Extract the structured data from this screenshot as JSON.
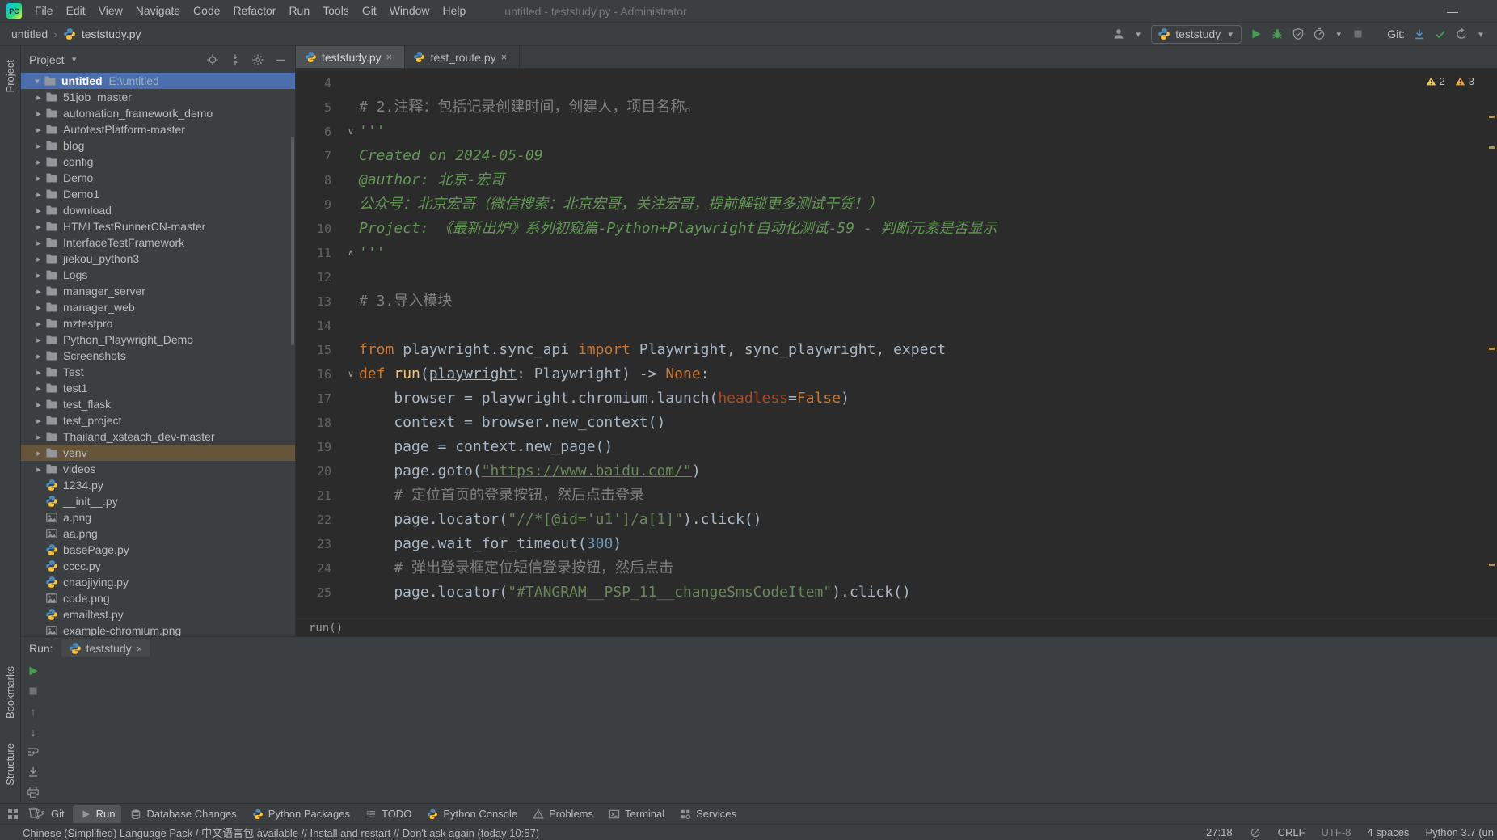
{
  "accent_colors": {
    "selection_blue": "#4b6eaf",
    "scope_brown": "#66543b",
    "run_green": "#499C54",
    "warning_yellow": "#f2c55c",
    "keyword_orange": "#cc7832",
    "string_green": "#6a8759",
    "docstring_green": "#629755",
    "comment_gray": "#808080",
    "number_blue": "#6897bb"
  },
  "title_bar": {
    "logo_text": "PC",
    "menus": [
      "File",
      "Edit",
      "View",
      "Navigate",
      "Code",
      "Refactor",
      "Run",
      "Tools",
      "Git",
      "Window",
      "Help"
    ],
    "window_title": "untitled - teststudy.py - Administrator",
    "minimize_glyph": "—"
  },
  "nav_bar": {
    "breadcrumb_project": "untitled",
    "breadcrumb_separator": "›",
    "breadcrumb_file": "teststudy.py",
    "run_config": "teststudy",
    "git_label": "Git:"
  },
  "tool_strips": {
    "left_top": "Project",
    "left_bottom": [
      "Bookmarks",
      "Structure"
    ]
  },
  "project_panel": {
    "header_label": "Project",
    "root_name": "untitled",
    "root_path": "E:\\untitled",
    "items": [
      {
        "name": "51job_master",
        "type": "folder"
      },
      {
        "name": "automation_framework_demo",
        "type": "folder"
      },
      {
        "name": "AutotestPlatform-master",
        "type": "folder"
      },
      {
        "name": "blog",
        "type": "folder"
      },
      {
        "name": "config",
        "type": "folder"
      },
      {
        "name": "Demo",
        "type": "folder"
      },
      {
        "name": "Demo1",
        "type": "folder"
      },
      {
        "name": "download",
        "type": "folder"
      },
      {
        "name": "HTMLTestRunnerCN-master",
        "type": "folder"
      },
      {
        "name": "InterfaceTestFramework",
        "type": "folder"
      },
      {
        "name": "jiekou_python3",
        "type": "folder"
      },
      {
        "name": "Logs",
        "type": "folder"
      },
      {
        "name": "manager_server",
        "type": "folder"
      },
      {
        "name": "manager_web",
        "type": "folder"
      },
      {
        "name": "mztestpro",
        "type": "folder"
      },
      {
        "name": "Python_Playwright_Demo",
        "type": "folder"
      },
      {
        "name": "Screenshots",
        "type": "folder"
      },
      {
        "name": "Test",
        "type": "folder"
      },
      {
        "name": "test1",
        "type": "folder"
      },
      {
        "name": "test_flask",
        "type": "folder"
      },
      {
        "name": "test_project",
        "type": "folder"
      },
      {
        "name": "Thailand_xsteach_dev-master",
        "type": "folder"
      },
      {
        "name": "venv",
        "type": "folder",
        "highlight": true
      },
      {
        "name": "videos",
        "type": "folder"
      },
      {
        "name": "1234.py",
        "type": "py"
      },
      {
        "name": "__init__.py",
        "type": "py"
      },
      {
        "name": "a.png",
        "type": "img"
      },
      {
        "name": "aa.png",
        "type": "img"
      },
      {
        "name": "basePage.py",
        "type": "py"
      },
      {
        "name": "cccc.py",
        "type": "py"
      },
      {
        "name": "chaojiying.py",
        "type": "py"
      },
      {
        "name": "code.png",
        "type": "img"
      },
      {
        "name": "emailtest.py",
        "type": "py"
      },
      {
        "name": "example-chromium.png",
        "type": "img"
      }
    ]
  },
  "editor": {
    "tabs": [
      {
        "label": "teststudy.py",
        "active": true
      },
      {
        "label": "test_route.py",
        "active": false
      }
    ],
    "inspections": [
      {
        "icon": "warning-icon",
        "count": "2"
      },
      {
        "icon": "warning2-icon",
        "count": "3"
      }
    ],
    "breadcrumb": "run()",
    "lines": [
      {
        "no": "4",
        "tokens": []
      },
      {
        "no": "5",
        "tokens": [
          [
            "com",
            "# 2.注释：包括记录创建时间，创建人，项目名称。"
          ]
        ]
      },
      {
        "no": "6",
        "fold": "open",
        "tokens": [
          [
            "doc",
            "'''"
          ]
        ]
      },
      {
        "no": "7",
        "tokens": [
          [
            "doc",
            "Created on 2024-05-09"
          ]
        ]
      },
      {
        "no": "8",
        "tokens": [
          [
            "doc",
            "@author: 北京-宏哥"
          ]
        ]
      },
      {
        "no": "9",
        "tokens": [
          [
            "doc",
            "公众号：北京宏哥（微信搜索：北京宏哥，关注宏哥，提前解锁更多测试干货！）"
          ]
        ]
      },
      {
        "no": "10",
        "tokens": [
          [
            "doc",
            "Project: 《最新出炉》系列初窥篇-Python+Playwright自动化测试-59 - 判断元素是否显示"
          ]
        ]
      },
      {
        "no": "11",
        "fold": "close",
        "tokens": [
          [
            "doc",
            "'''"
          ]
        ]
      },
      {
        "no": "12",
        "tokens": []
      },
      {
        "no": "13",
        "tokens": [
          [
            "com",
            "# 3.导入模块"
          ]
        ]
      },
      {
        "no": "14",
        "tokens": []
      },
      {
        "no": "15",
        "tokens": [
          [
            "kw",
            "from"
          ],
          [
            "pl",
            " playwright.sync_api "
          ],
          [
            "kw",
            "import"
          ],
          [
            "pl",
            " Playwright, sync_playwright, expect"
          ]
        ]
      },
      {
        "no": "16",
        "fold": "open",
        "tokens": [
          [
            "kw",
            "def "
          ],
          [
            "fn",
            "run"
          ],
          [
            "pl",
            "("
          ],
          [
            "pm",
            "playwright"
          ],
          [
            "pl",
            ": Playwright) -> "
          ],
          [
            "kw",
            "None"
          ],
          [
            "pl",
            ":"
          ]
        ]
      },
      {
        "no": "17",
        "tokens": [
          [
            "pl",
            "    browser = playwright.chromium.launch("
          ],
          [
            "na",
            "headless"
          ],
          [
            "pl",
            "="
          ],
          [
            "kw",
            "False"
          ],
          [
            "pl",
            ")"
          ]
        ]
      },
      {
        "no": "18",
        "tokens": [
          [
            "pl",
            "    context = browser.new_context()"
          ]
        ]
      },
      {
        "no": "19",
        "tokens": [
          [
            "pl",
            "    page = context.new_page()"
          ]
        ]
      },
      {
        "no": "20",
        "tokens": [
          [
            "pl",
            "    page.goto("
          ],
          [
            "su",
            "\"https://www.baidu.com/\""
          ],
          [
            "pl",
            ")"
          ]
        ]
      },
      {
        "no": "21",
        "tokens": [
          [
            "com",
            "    # 定位首页的登录按钮，然后点击登录"
          ]
        ]
      },
      {
        "no": "22",
        "tokens": [
          [
            "pl",
            "    page.locator("
          ],
          [
            "st",
            "\"//*[@id='u1']/a[1]\""
          ],
          [
            "pl",
            ").click()"
          ]
        ]
      },
      {
        "no": "23",
        "tokens": [
          [
            "pl",
            "    page.wait_for_timeout("
          ],
          [
            "nu",
            "300"
          ],
          [
            "pl",
            ")"
          ]
        ]
      },
      {
        "no": "24",
        "tokens": [
          [
            "com",
            "    # 弹出登录框定位短信登录按钮，然后点击"
          ]
        ]
      },
      {
        "no": "25",
        "tokens": [
          [
            "pl",
            "    page.locator("
          ],
          [
            "st",
            "\"#TANGRAM__PSP_11__changeSmsCodeItem\""
          ],
          [
            "pl",
            ").click()"
          ]
        ]
      }
    ]
  },
  "run_panel": {
    "label": "Run:",
    "tab_label": "teststudy",
    "tools": [
      "rerun-icon",
      "stop-icon",
      "up-icon",
      "down-icon",
      "softwrap-icon",
      "scrollend-icon",
      "print-icon",
      "clear-icon"
    ]
  },
  "bottom_bar": {
    "items": [
      {
        "label": "Git",
        "icon": "branch-icon"
      },
      {
        "label": "Run",
        "icon": "play-icon",
        "active": true
      },
      {
        "label": "Database Changes",
        "icon": "database-icon"
      },
      {
        "label": "Python Packages",
        "icon": "python-icon"
      },
      {
        "label": "TODO",
        "icon": "todo-icon"
      },
      {
        "label": "Python Console",
        "icon": "python-icon"
      },
      {
        "label": "Problems",
        "icon": "problems-icon"
      },
      {
        "label": "Terminal",
        "icon": "terminal-icon"
      },
      {
        "label": "Services",
        "icon": "services-icon"
      }
    ]
  },
  "status_bar": {
    "message": "Chinese (Simplified) Language Pack / 中文语言包 available // Install and restart // Don't ask again (today 10:57)",
    "cursor_position": "27:18",
    "line_separator": "CRLF",
    "encoding": "UTF-8",
    "indent": "4 spaces",
    "interpreter": "Python 3.7 (un"
  }
}
